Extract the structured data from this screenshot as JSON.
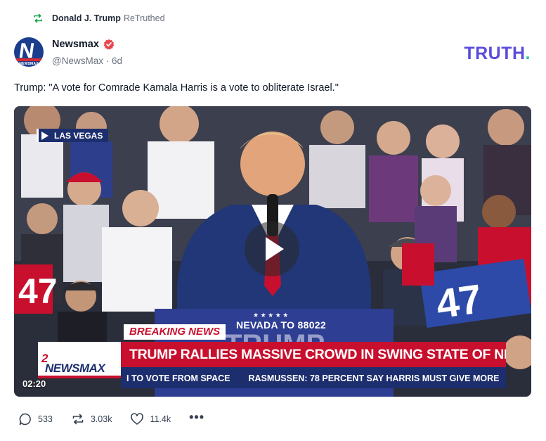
{
  "retruth": {
    "user": "Donald J. Trump",
    "label": "ReTruthed",
    "icon": "retruth-icon"
  },
  "author": {
    "name": "Newsmax",
    "handle": "@NewsMax",
    "age": "6d",
    "avatar_text": "NEWSMAX",
    "verified_icon": "verified-badge-icon"
  },
  "brand": {
    "logo_main": "TRUTH",
    "logo_dot": "."
  },
  "post": {
    "text": "Trump: \"A vote for Comrade Kamala Harris is a vote to obliterate Israel.\""
  },
  "video": {
    "location": "LAS VEGAS",
    "duration": "02:20",
    "breaking": "BREAKING NEWS",
    "nevada": "NEVADA TO 88022",
    "network_a": "NEWSMAX",
    "network_b": "2",
    "headline": "TRUMP RALLIES MASSIVE CROWD IN SWING STATE OF NEVADA",
    "ticker_1": "I TO VOTE FROM SPACE",
    "ticker_2": "RASMUSSEN: 78 PERCENT SAY HARRIS MUST GIVE MORE",
    "sign_1": "47",
    "sign_2": "47"
  },
  "actions": {
    "replies": "533",
    "retruths": "3.03k",
    "likes": "11.4k",
    "more": "•••"
  },
  "colors": {
    "brand_purple": "#5b4bdb",
    "brand_teal": "#22c7a9",
    "newsmax_red": "#c8102e",
    "newsmax_navy": "#1d2e6e",
    "verified": "#e5484d"
  }
}
